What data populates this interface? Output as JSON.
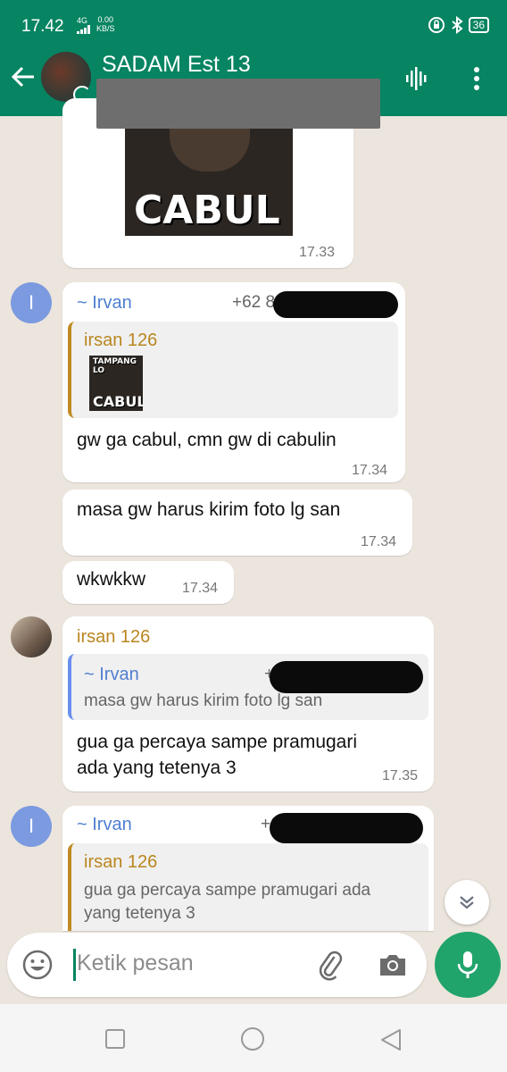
{
  "status_bar": {
    "time": "17.42",
    "network": "4G",
    "speed_value": "0.00",
    "speed_unit": "KB/S",
    "battery": "36"
  },
  "header": {
    "title": "SADAM Est 13"
  },
  "messages": {
    "m1": {
      "time": "17.33",
      "meme_caption": "CABUL"
    },
    "m2": {
      "sender": "~ Irvan",
      "phone": "+62 8",
      "quote_sender": "irsan 126",
      "quote_thumb_top": "TAMPANG LO",
      "quote_thumb_caption": "CABUL",
      "text": "gw ga cabul, cmn gw di cabulin",
      "time": "17.34"
    },
    "m3": {
      "text": "masa gw harus kirim foto lg san",
      "time": "17.34"
    },
    "m4": {
      "text": "wkwkkw",
      "time": "17.34"
    },
    "m5": {
      "sender": "irsan 126",
      "quote_sender": "~ Irvan",
      "quote_phone": "+62",
      "quote_text": "masa gw harus kirim foto lg san",
      "text_line1": "gua ga percaya sampe pramugari",
      "text_line2": "ada yang tetenya 3",
      "time": "17.35"
    },
    "m6": {
      "sender": "~ Irvan",
      "phone": "+62 8",
      "quote_sender": "irsan 126",
      "quote_text_line1": "gua ga percaya sampe pramugari ada",
      "quote_text_line2": "yang tetenya 3"
    }
  },
  "avatars": {
    "irvan_initial": "I"
  },
  "composer": {
    "placeholder": "Ketik pesan"
  },
  "colors": {
    "header": "#078462",
    "background": "#ece5dd",
    "mic": "#21a46b",
    "sender_blue": "#4f7fd0",
    "sender_gold": "#b9861f"
  },
  "icons": {
    "back": "arrow-left-icon",
    "voice": "audio-wave-icon",
    "menu": "more-vertical-icon",
    "emoji": "emoji-icon",
    "attach": "paperclip-icon",
    "camera": "camera-icon",
    "mic": "mic-icon",
    "scroll_down": "double-chevron-down-icon"
  }
}
